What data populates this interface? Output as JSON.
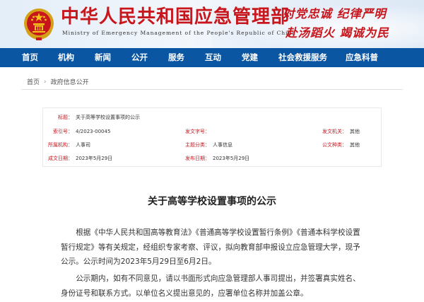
{
  "header": {
    "title_cn": "中华人民共和国应急管理部",
    "title_en": "Ministry of Emergency Management of the People's Republic of China",
    "slogan_line1": "对党忠诚 纪律严明",
    "slogan_line2": "赴汤蹈火 竭诚为民",
    "brand_red": "#c8161d",
    "nav_blue": "#0b56a3"
  },
  "nav": {
    "items": [
      "首页",
      "机构",
      "新闻",
      "公开",
      "服务",
      "互动",
      "党建",
      "社会救援服务",
      "应急科普"
    ]
  },
  "breadcrumb": {
    "home": "首页",
    "separator": "›",
    "current": "政府信息公开"
  },
  "meta": {
    "title_label": "标题：",
    "title_value": "关于高等学校设置事项的公示",
    "index_label": "索引号：",
    "index_value": "4/2023-00045",
    "doc_no_label": "发文字号：",
    "doc_no_value": "",
    "doc_org_label": "发文机关：",
    "doc_org_value": "其他",
    "source_label": "所属机构：",
    "source_value": "人事司",
    "topic_label": "主题分类：",
    "topic_value": "人事信息",
    "form_label": "公文种类：",
    "form_value": "其他",
    "date_label": "成文日期：",
    "date_value": "2023年5月29日",
    "pub_label": "发布日期：",
    "pub_value": "2023年5月29日"
  },
  "article": {
    "title": "关于高等学校设置事项的公示",
    "para1": "根据《中华人民共和国高等教育法》《普通高等学校设置暂行条例》《普通本科学校设置暂行规定》等有关规定，经组织专家考察、评议，拟向教育部申报设立应急管理大学，现予公示。公示时间为2023年5月29日至6月2日。",
    "para2": "公示期内，如有不同意见，请以书面形式向应急管理部人事司提出，并签署真实姓名、身份证号和联系方式。以单位名义提出意见的，应署单位名称并加盖公章。"
  }
}
